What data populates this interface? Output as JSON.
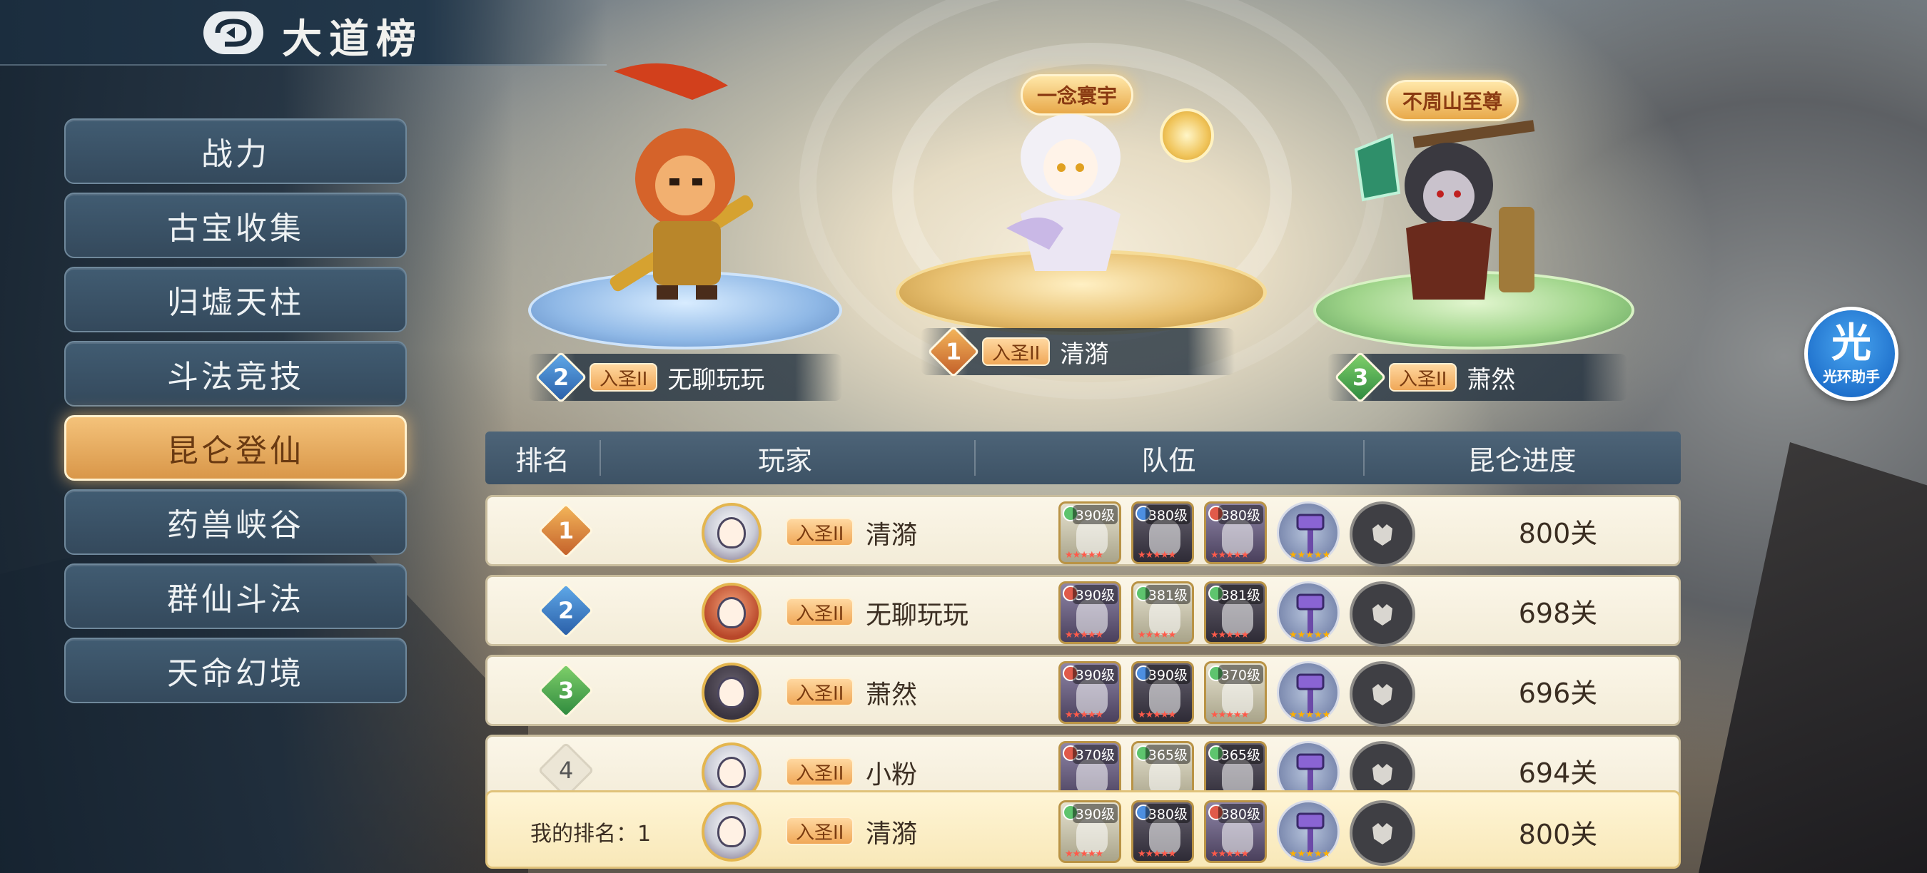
{
  "header": {
    "title": "大道榜"
  },
  "sidebar": {
    "items": [
      {
        "label": "战力"
      },
      {
        "label": "古宝收集"
      },
      {
        "label": "归墟天柱"
      },
      {
        "label": "斗法竞技"
      },
      {
        "label": "昆仑登仙"
      },
      {
        "label": "药兽峡谷"
      },
      {
        "label": "群仙斗法"
      },
      {
        "label": "天命幻境"
      }
    ],
    "active_index": 4
  },
  "podium": {
    "first": {
      "rank": "1",
      "realm": "入圣II",
      "name": "清漪",
      "title_banner": "一念寰宇"
    },
    "second": {
      "rank": "2",
      "realm": "入圣II",
      "name": "无聊玩玩"
    },
    "third": {
      "rank": "3",
      "realm": "入圣II",
      "name": "萧然",
      "title_banner": "不周山至尊"
    }
  },
  "table": {
    "headers": [
      "排名",
      "玩家",
      "队伍",
      "昆仑进度"
    ],
    "rows": [
      {
        "rank": "1",
        "realm": "入圣II",
        "name": "清漪",
        "levels": [
          "390级",
          "380级",
          "380级"
        ],
        "progress": "800关"
      },
      {
        "rank": "2",
        "realm": "入圣II",
        "name": "无聊玩玩",
        "levels": [
          "390级",
          "381级",
          "381级"
        ],
        "progress": "698关"
      },
      {
        "rank": "3",
        "realm": "入圣II",
        "name": "萧然",
        "levels": [
          "390级",
          "390级",
          "370级"
        ],
        "progress": "696关"
      },
      {
        "rank": "4",
        "realm": "入圣II",
        "name": "小粉",
        "levels": [
          "370级",
          "365级",
          "365级"
        ],
        "progress": "694关"
      }
    ]
  },
  "my_rank": {
    "label": "我的排名：1",
    "realm": "入圣II",
    "name": "清漪",
    "levels": [
      "390级",
      "380级",
      "380级"
    ],
    "progress": "800关"
  },
  "assistant": {
    "glyph": "光",
    "label": "光环助手"
  },
  "icons": [
    "back-icon",
    "avatar",
    "unit-portrait",
    "hammer-icon",
    "pet-icon"
  ],
  "colors": {
    "accent_active": "#e8a34f",
    "rank1": "#d87a33",
    "rank2": "#3b7fd0",
    "rank3": "#3f9a48"
  }
}
